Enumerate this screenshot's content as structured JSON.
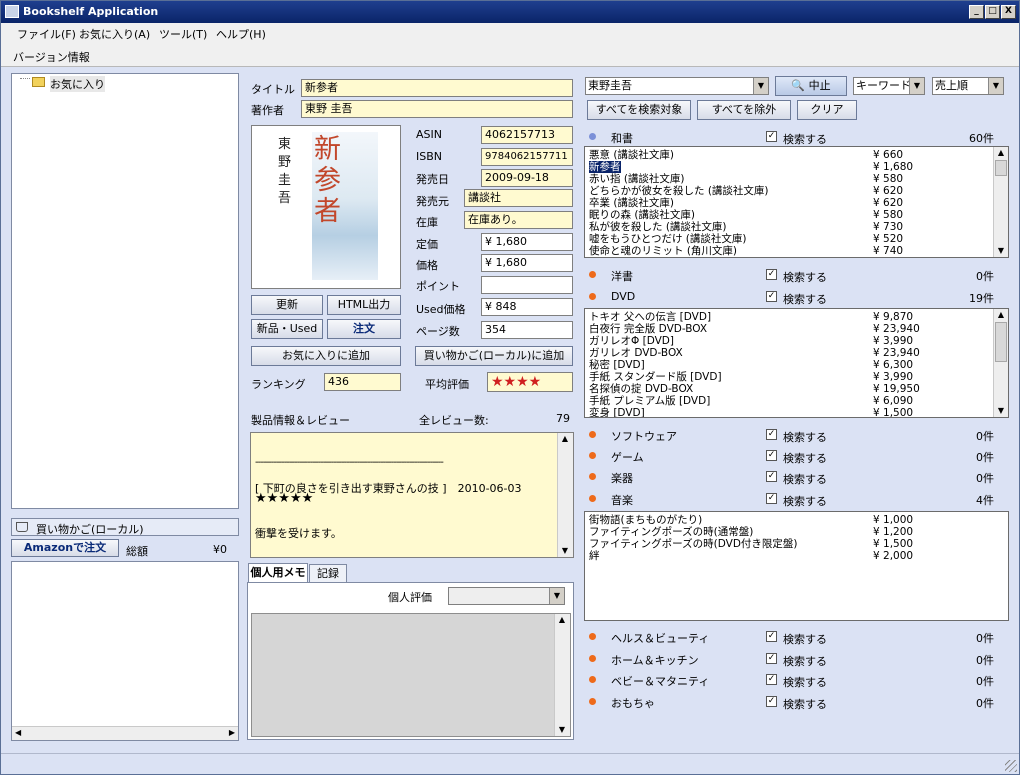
{
  "window": {
    "title": "Bookshelf Application",
    "btn_min": "_",
    "btn_max": "□",
    "btn_close": "X"
  },
  "menu": {
    "file": "ファイル(F)",
    "favorites": "お気に入り(A)",
    "tools": "ツール(T)",
    "help": "ヘルプ(H)"
  },
  "subbar": {
    "version": "バージョン情報"
  },
  "tree": {
    "root": "お気に入り"
  },
  "cart": {
    "header": "買い物かご(ローカル)",
    "amazon_order": "Amazonで注文",
    "total_label": "総額",
    "total_value": "¥0"
  },
  "book": {
    "title_label": "タイトル",
    "title_value": "新参者",
    "author_label": "著作者",
    "author_value": "東野 圭吾",
    "asin_label": "ASIN",
    "asin_value": "4062157713",
    "isbn_label": "ISBN",
    "isbn_value": "9784062157711",
    "date_label": "発売日",
    "date_value": "2009-09-18",
    "publisher_label": "発売元",
    "publisher_value": "講談社",
    "stock_label": "在庫",
    "stock_value": "在庫あり。",
    "list_price_label": "定価",
    "list_price_value": "¥ 1,680",
    "price_label": "価格",
    "price_value": "¥ 1,680",
    "points_label": "ポイント",
    "points_value": "",
    "used_label": "Used価格",
    "used_value": "¥ 848",
    "pages_label": "ページ数",
    "pages_value": "354",
    "ranking_label": "ランキング",
    "ranking_value": "436",
    "avg_label": "平均評価",
    "avg_stars": "★★★★",
    "cover_author": "東野圭吾",
    "cover_title": "新参者"
  },
  "actions": {
    "update": "更新",
    "html_out": "HTML出力",
    "new_used": "新品・Used",
    "order": "注文",
    "add_fav": "お気に入りに追加",
    "add_cart": "買い物かご(ローカル)に追加"
  },
  "review": {
    "header": "製品情報＆レビュー",
    "total_label": "全レビュー数:",
    "total_value": "79",
    "divider": "------------------------------------------------------------------------",
    "headline": "[ 下町の良さを引き出す東野さんの技 ]　2010-06-03",
    "stars": "★★★★★",
    "text": "衝撃を受けます。"
  },
  "memo": {
    "tab_memo": "個人用メモ",
    "tab_log": "記録",
    "rating_label": "個人評価"
  },
  "search": {
    "query": "東野圭吾",
    "stop": "中止",
    "mode": "キーワード",
    "sort": "売上順",
    "select_all": "すべてを検索対象",
    "exclude_all": "すべてを除外",
    "clear": "クリア",
    "check_label": "検索する",
    "check_mark": "✓"
  },
  "categories": [
    {
      "name": "和書",
      "count": "60件"
    },
    {
      "name": "洋書",
      "count": "0件"
    },
    {
      "name": "DVD",
      "count": "19件"
    },
    {
      "name": "ソフトウェア",
      "count": "0件"
    },
    {
      "name": "ゲーム",
      "count": "0件"
    },
    {
      "name": "楽器",
      "count": "0件"
    },
    {
      "name": "音楽",
      "count": "4件"
    },
    {
      "name": "ヘルス＆ビューティ",
      "count": "0件"
    },
    {
      "name": "ホーム＆キッチン",
      "count": "0件"
    },
    {
      "name": "ベビー＆マタニティ",
      "count": "0件"
    },
    {
      "name": "おもちゃ",
      "count": "0件"
    }
  ],
  "books_list": [
    {
      "name": "悪意 (講談社文庫)",
      "price": "¥ 660"
    },
    {
      "name": "新参者",
      "price": "¥ 1,680"
    },
    {
      "name": "赤い指 (講談社文庫)",
      "price": "¥ 580"
    },
    {
      "name": "どちらかが彼女を殺した (講談社文庫)",
      "price": "¥ 620"
    },
    {
      "name": "卒業 (講談社文庫)",
      "price": "¥ 620"
    },
    {
      "name": "眠りの森 (講談社文庫)",
      "price": "¥ 580"
    },
    {
      "name": "私が彼を殺した (講談社文庫)",
      "price": "¥ 730"
    },
    {
      "name": "嘘をもうひとつだけ (講談社文庫)",
      "price": "¥ 520"
    },
    {
      "name": "使命と魂のリミット (角川文庫)",
      "price": "¥ 740"
    }
  ],
  "dvd_list": [
    {
      "name": "トキオ 父への伝言 [DVD]",
      "price": "¥ 9,870"
    },
    {
      "name": "白夜行 完全版 DVD-BOX",
      "price": "¥ 23,940"
    },
    {
      "name": "ガリレオΦ [DVD]",
      "price": "¥ 3,990"
    },
    {
      "name": "ガリレオ DVD-BOX",
      "price": "¥ 23,940"
    },
    {
      "name": "秘密 [DVD]",
      "price": "¥ 6,300"
    },
    {
      "name": "手紙 スタンダード版 [DVD]",
      "price": "¥ 3,990"
    },
    {
      "name": "名探偵の掟 DVD-BOX",
      "price": "¥ 19,950"
    },
    {
      "name": "手紙 プレミアム版 [DVD]",
      "price": "¥ 6,090"
    },
    {
      "name": "変身 [DVD]",
      "price": "¥ 1,500"
    }
  ],
  "music_list": [
    {
      "name": "街物語(まちものがたり)",
      "price": "¥ 1,000"
    },
    {
      "name": "ファイティングポーズの時(通常盤)",
      "price": "¥ 1,200"
    },
    {
      "name": "ファイティングポーズの時(DVD付き限定盤)",
      "price": "¥ 1,500"
    },
    {
      "name": "絆",
      "price": "¥ 2,000"
    }
  ],
  "colors": {
    "accent": "#0a2468",
    "field": "#fffad0",
    "window": "#dbe2f4",
    "dot": "#ee6a1a"
  }
}
